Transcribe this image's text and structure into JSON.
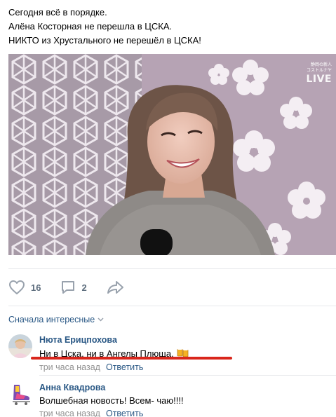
{
  "post": {
    "lines": [
      "Сегодня всё в порядке.",
      "Алёна Косторная не перешла в ЦСКА.",
      "НИКТО из Хрустального не перешёл в ЦСКА!"
    ],
    "photo_caption": {
      "small_line_1": "静岡の新人",
      "small_line_2": "コストルナヤ",
      "live": "LIVE"
    }
  },
  "actions": {
    "likes_icon": "heart-icon",
    "likes": "16",
    "comments_icon": "comment-icon",
    "comments": "2",
    "share_icon": "share-arrow-icon"
  },
  "comments_section": {
    "sort_label": "Сначала интересные",
    "sort_icon": "chevron-down-icon",
    "comments": [
      {
        "author": "Нюта Ерицпохова",
        "text": "Ни в Цска, ни в Ангелы Плюща.",
        "emoji": "beer-mugs-icon",
        "time": "три часа назад",
        "reply": "Ответить"
      },
      {
        "author": "Анна Квадрова",
        "text": "Волшебная новость! Всем- чаю!!!!",
        "time": "три часа назад",
        "reply": "Ответить"
      }
    ]
  },
  "colors": {
    "link": "#2a5885",
    "meta": "#939393",
    "icon": "#99a2ad",
    "highlight": "#d9261c"
  }
}
